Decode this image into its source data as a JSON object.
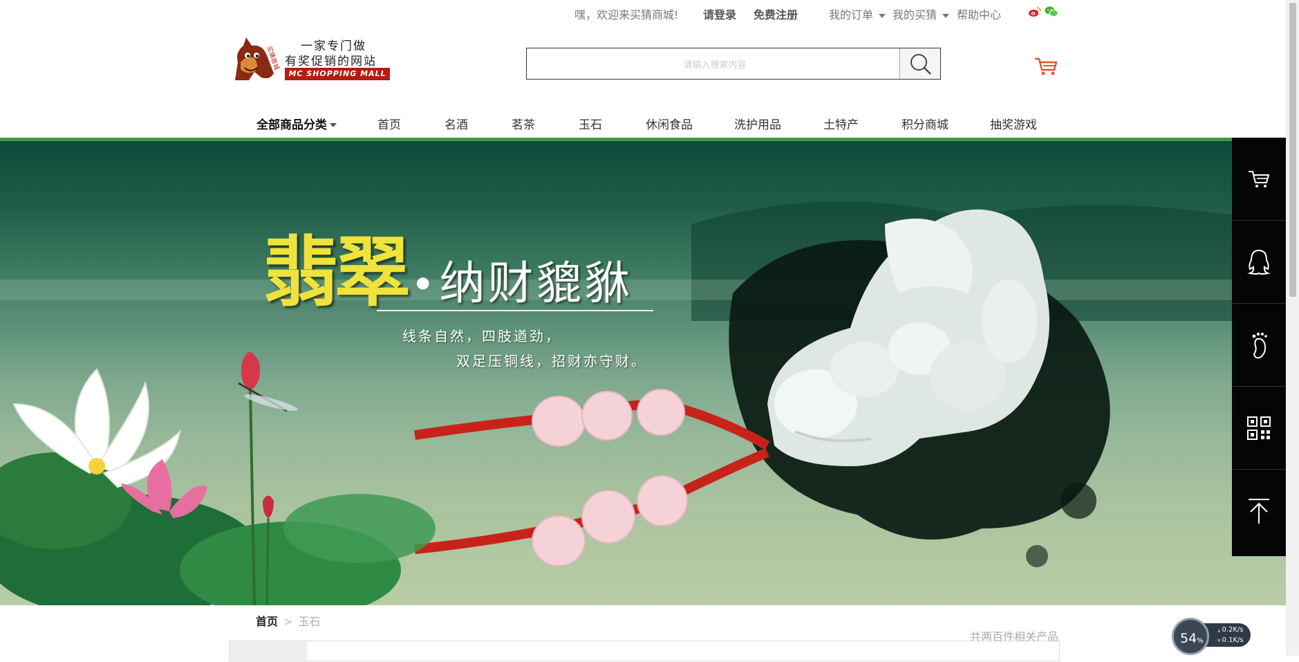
{
  "topbar": {
    "welcome": "嘿，欢迎来买猜商城!",
    "login": "请登录",
    "register": "免费注册",
    "my_orders": "我的订单",
    "my_bets": "我的买猜",
    "help": "帮助中心",
    "social_icons": [
      "weibo-icon",
      "wechat-icon"
    ]
  },
  "logo": {
    "tagline_1": "一家专门做",
    "tagline_2": "有奖促销的网站",
    "plate": "MC SHOPPING MALL"
  },
  "search": {
    "placeholder": "请输入搜索内容",
    "value": ""
  },
  "nav": {
    "all_categories": "全部商品分类",
    "items": [
      "首页",
      "名酒",
      "茗茶",
      "玉石",
      "休闲食品",
      "洗护用品",
      "土特产",
      "积分商城",
      "抽奖游戏"
    ]
  },
  "banner": {
    "title_big": "翡翠",
    "title_dot": "•",
    "title_sub": "纳财貔貅",
    "line_1": "线条自然，四肢遒劲，",
    "line_2": "双足压铜线，招财亦守财。"
  },
  "sidebar": {
    "tools": [
      "cart-icon",
      "qq-icon",
      "footprint-icon",
      "qrcode-icon",
      "back-to-top-icon"
    ]
  },
  "breadcrumb": {
    "home": "首页",
    "separator": ">",
    "current": "玉石"
  },
  "result_count": "共两百件相关产品",
  "speed_widget": {
    "percent": "54",
    "percent_unit": "%",
    "upload": "0.2K/s",
    "download": "0.1K/s"
  },
  "colors": {
    "brand_red": "#b31d12",
    "nav_green": "#3a9a48",
    "cart_orange": "#e8541d",
    "sidebar_black": "#050505"
  }
}
